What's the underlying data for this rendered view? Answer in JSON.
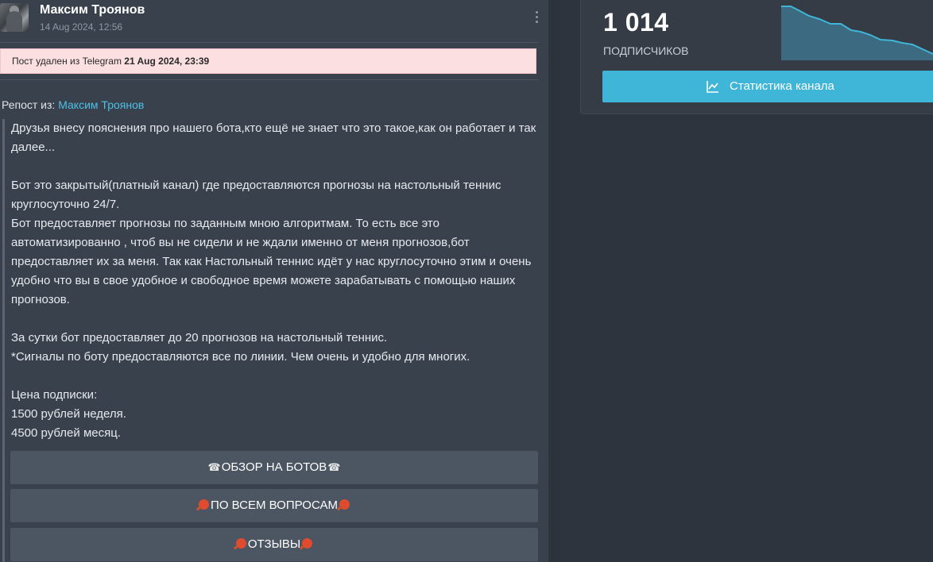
{
  "post": {
    "author": "Максим Троянов",
    "date": "14 Aug 2024, 12:56",
    "deleted_prefix": "Пост удален из Telegram",
    "deleted_date": "21 Aug 2024, 23:39",
    "repost_prefix": "Репост из:",
    "repost_author": "Максим Троянов",
    "paragraphs": [
      "Друзья внесу пояснения про нашего бота,кто ещё не знает что это такое,как он работает и так далее...",
      "",
      "Бот это закрытый(платный канал) где предоставляются прогнозы на настольный теннис круглосуточно 24/7.",
      "Бот предоставляет прогнозы по заданным мною алгоритмам. То есть все это автоматизированно , чтоб вы не сидели и не ждали именно от меня прогнозов,бот предоставляет их за меня. Так как Настольный теннис идёт у нас круглосуточно этим и очень удобно что вы в свое удобное и свободное время можете зарабатывать с помощью наших прогнозов.",
      "",
      "За сутки бот предоставляет до 20 прогнозов на настольный теннис.",
      "*Сигналы по боту предоставляются все по линии. Чем очень и удобно для многих.",
      "",
      "Цена подписки:",
      "1500 рублей неделя.",
      "4500 рублей месяц."
    ],
    "buttons": [
      {
        "label": "ОБЗОР НА БОТОВ",
        "icon": "phone-icon"
      },
      {
        "label": "ПО ВСЕМ ВОПРОСАМ",
        "icon": "ping-pong-icon"
      },
      {
        "label": "ОТЗЫВЫ",
        "icon": "ping-pong-icon"
      }
    ]
  },
  "channel": {
    "subscribers": "1 014",
    "subscribers_label": "ПОДПИСЧИКОВ",
    "stats_button": "Статистика канала",
    "stats_icon": "line-chart-icon",
    "accent": "#3fb5d8"
  }
}
